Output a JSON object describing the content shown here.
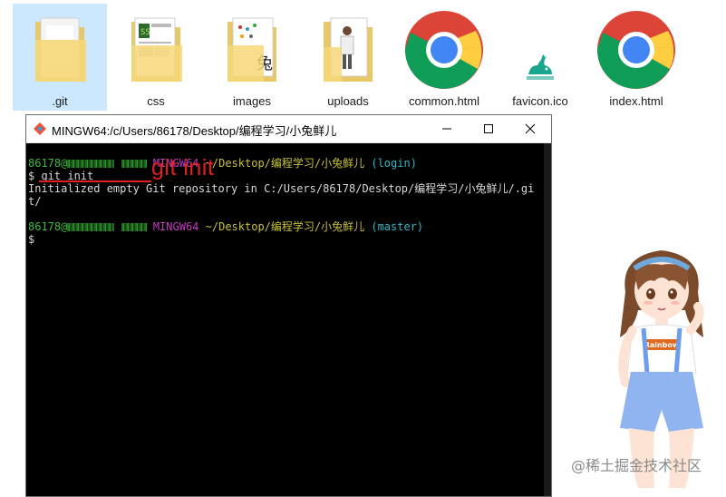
{
  "explorer": {
    "items": [
      {
        "label": ".git",
        "icon": "folder-icon",
        "selected": true
      },
      {
        "label": "css",
        "icon": "folder-icon",
        "selected": false
      },
      {
        "label": "images",
        "icon": "folder-icon",
        "selected": false
      },
      {
        "label": "uploads",
        "icon": "folder-icon",
        "selected": false
      },
      {
        "label": "common.html",
        "icon": "chrome-icon",
        "selected": false
      },
      {
        "label": "favicon.ico",
        "icon": "rabbit-icon",
        "selected": false
      },
      {
        "label": "index.html",
        "icon": "chrome-icon",
        "selected": false
      }
    ]
  },
  "terminal": {
    "title": "MINGW64:/c/Users/86178/Desktop/编程学习/小兔鲜儿",
    "prompt1": {
      "user": "86178@",
      "host": "MINGW64",
      "path": "~/Desktop/编程学习/小兔鲜儿",
      "branch": "(login)"
    },
    "command_prefix": "$ ",
    "command": "git init",
    "output_line1": "Initialized empty Git repository in C:/Users/86178/Desktop/编程学习/小兔鲜儿/.gi",
    "output_line2": "t/",
    "prompt2": {
      "user": "86178@",
      "host": "MINGW64",
      "path": "~/Desktop/编程学习/小兔鲜儿",
      "branch": "(master)"
    },
    "cursor_prompt": "$",
    "annotation": "git init"
  },
  "decoration": {
    "shirt_text": "Rainbow",
    "watermark": "@稀土掘金技术社区"
  }
}
